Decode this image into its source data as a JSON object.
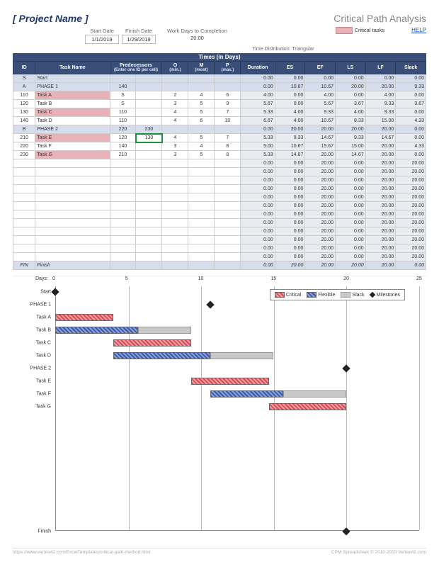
{
  "header": {
    "project": "[ Project Name ]",
    "title": "Critical Path Analysis"
  },
  "meta": {
    "start_lbl": "Start Date",
    "start": "1/1/2019",
    "finish_lbl": "Finish Date",
    "finish": "1/29/2019",
    "wdc_lbl": "Work Days to Completion",
    "wdc": "20.00",
    "crit_lbl": "Critical tasks",
    "help": "HELP"
  },
  "dist": {
    "lbl": "Time Distribution:",
    "val": "Triangular",
    "times": "Times (in Days)"
  },
  "cols": [
    "ID",
    "Task Name",
    "Predecessors",
    "",
    "O",
    "M",
    "P",
    "Duration",
    "ES",
    "EF",
    "LS",
    "LF",
    "Slack"
  ],
  "sub": "(Enter one ID per cell)",
  "sub2": [
    "(min.)",
    "(most)",
    "(max.)"
  ],
  "rows": [
    {
      "id": "S",
      "name": "Start",
      "cls": "phase",
      "v": [
        "",
        "",
        "",
        "",
        "",
        "0.00",
        "0.00",
        "0.00",
        "0.00",
        "0.00",
        "0.00"
      ]
    },
    {
      "id": "A",
      "name": "PHASE 1",
      "cls": "phase",
      "v": [
        "140",
        "",
        "",
        "",
        "",
        "0.00",
        "10.67",
        "10.67",
        "20.00",
        "20.00",
        "9.33"
      ]
    },
    {
      "id": "110",
      "name": "Task A",
      "cls": "crit",
      "v": [
        "S",
        "",
        "2",
        "4",
        "6",
        "4.00",
        "0.00",
        "4.00",
        "0.00",
        "4.00",
        "0.00"
      ]
    },
    {
      "id": "120",
      "name": "Task B",
      "cls": "",
      "v": [
        "S",
        "",
        "3",
        "5",
        "9",
        "5.67",
        "0.00",
        "5.67",
        "3.67",
        "9.33",
        "3.67"
      ]
    },
    {
      "id": "130",
      "name": "Task C",
      "cls": "crit",
      "v": [
        "110",
        "",
        "4",
        "5",
        "7",
        "5.33",
        "4.00",
        "9.33",
        "4.00",
        "9.33",
        "0.00"
      ]
    },
    {
      "id": "140",
      "name": "Task D",
      "cls": "",
      "v": [
        "110",
        "",
        "4",
        "6",
        "10",
        "6.67",
        "4.00",
        "10.67",
        "8.33",
        "15.00",
        "4.33"
      ]
    },
    {
      "id": "B",
      "name": "PHASE 2",
      "cls": "phase",
      "v": [
        "220",
        "230",
        "",
        "",
        "",
        "0.00",
        "20.00",
        "20.00",
        "20.00",
        "20.00",
        "0.00"
      ]
    },
    {
      "id": "210",
      "name": "Task E",
      "cls": "crit",
      "v": [
        "120",
        "130",
        "4",
        "5",
        "7",
        "5.33",
        "9.33",
        "14.67",
        "9.33",
        "14.67",
        "0.00"
      ]
    },
    {
      "id": "220",
      "name": "Task F",
      "cls": "",
      "v": [
        "140",
        "",
        "3",
        "4",
        "8",
        "5.00",
        "10.67",
        "15.67",
        "15.00",
        "20.00",
        "4.33"
      ]
    },
    {
      "id": "230",
      "name": "Task G",
      "cls": "crit",
      "v": [
        "210",
        "",
        "3",
        "5",
        "8",
        "5.33",
        "14.67",
        "20.00",
        "14.67",
        "20.00",
        "0.00"
      ]
    }
  ],
  "empty_default": [
    "",
    "",
    "",
    "",
    "",
    "0.00",
    "0.00",
    "20.00",
    "0.00",
    "20.00",
    "20.00"
  ],
  "finish": {
    "id": "FIN",
    "name": "Finish",
    "v": [
      "",
      "",
      "",
      "",
      "",
      "0.00",
      "20.00",
      "20.00",
      "20.00",
      "20.00",
      "0.00"
    ]
  },
  "chart_data": {
    "type": "gantt",
    "xlabel": "Days:",
    "xticks": [
      0,
      5,
      10,
      15,
      20,
      25
    ],
    "xlim": [
      0,
      25
    ],
    "legend": [
      "Critical",
      "Flexible",
      "Slack",
      "Milestones"
    ],
    "tasks": [
      {
        "name": "Start",
        "mile": 0
      },
      {
        "name": "PHASE 1",
        "mile": 10.67
      },
      {
        "name": "Task A",
        "type": "crit",
        "es": 0,
        "ef": 4,
        "slack": 0
      },
      {
        "name": "Task B",
        "type": "flex",
        "es": 0,
        "ef": 5.67,
        "slack": 3.67
      },
      {
        "name": "Task C",
        "type": "crit",
        "es": 4,
        "ef": 9.33,
        "slack": 0
      },
      {
        "name": "Task D",
        "type": "flex",
        "es": 4,
        "ef": 10.67,
        "slack": 4.33
      },
      {
        "name": "PHASE 2",
        "mile": 20
      },
      {
        "name": "Task E",
        "type": "crit",
        "es": 9.33,
        "ef": 14.67,
        "slack": 0
      },
      {
        "name": "Task F",
        "type": "flex",
        "es": 10.67,
        "ef": 15.67,
        "slack": 4.33
      },
      {
        "name": "Task G",
        "type": "crit",
        "es": 14.67,
        "ef": 20,
        "slack": 0
      },
      {
        "name": "Finish",
        "mile": 20,
        "bottom": true
      }
    ]
  },
  "footer": {
    "l": "https://www.vertex42.com/ExcelTemplates/critical-path-method.html",
    "r": "CPM Spreadsheet © 2010-2019 Vertex42.com"
  }
}
